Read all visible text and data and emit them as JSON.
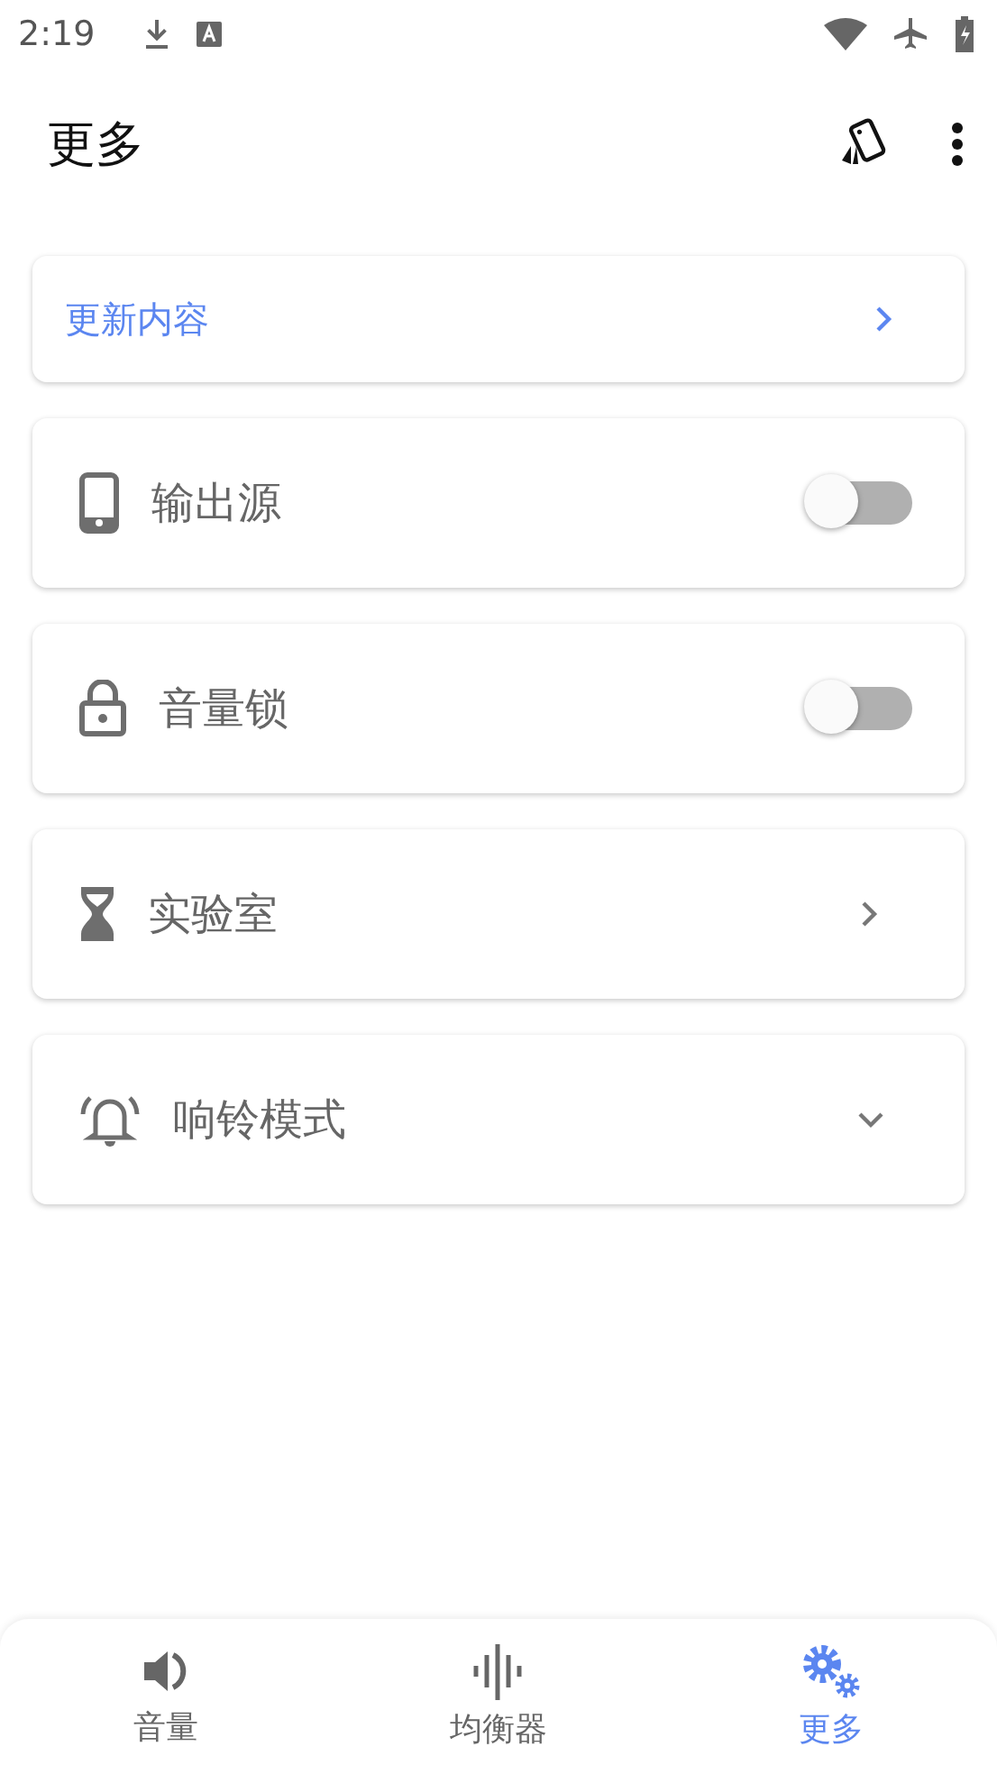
{
  "status_bar": {
    "time": "2:19"
  },
  "app_bar": {
    "title": "更多"
  },
  "banner": {
    "label": "更新内容"
  },
  "items": [
    {
      "kind": "toggle",
      "label": "输出源",
      "on": false
    },
    {
      "kind": "toggle",
      "label": "音量锁",
      "on": false
    },
    {
      "kind": "link",
      "label": "实验室"
    },
    {
      "kind": "expand",
      "label": "响铃模式",
      "expanded": false
    }
  ],
  "nav": [
    {
      "label": "音量",
      "selected": false
    },
    {
      "label": "均衡器",
      "selected": false
    },
    {
      "label": "更多",
      "selected": true
    }
  ]
}
